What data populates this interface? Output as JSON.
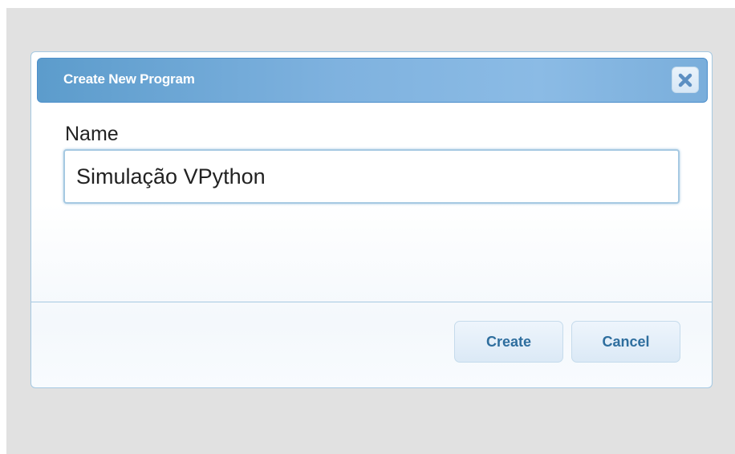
{
  "dialog": {
    "title": "Create New Program",
    "close_icon": "close-icon",
    "name_label": "Name",
    "name_value": "Simulação VPython",
    "buttons": {
      "create": "Create",
      "cancel": "Cancel"
    }
  },
  "colors": {
    "backdrop": "#e1e1e1",
    "titlebar": "#5c9ccc",
    "border": "#a6c9e2",
    "button_text": "#2e6e9e",
    "close_icon": "#5d8fc2"
  }
}
